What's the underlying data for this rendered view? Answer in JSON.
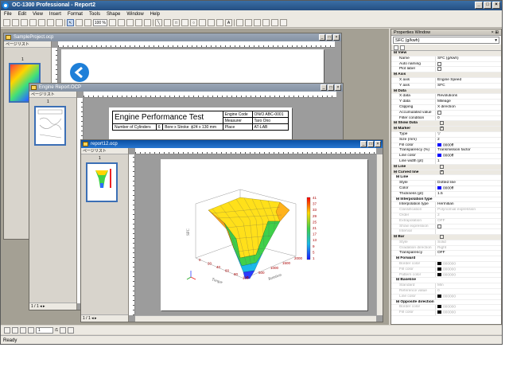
{
  "app": {
    "title": "OC-1300 Professional - Report2"
  },
  "menu": [
    "File",
    "Edit",
    "View",
    "Insert",
    "Format",
    "Tools",
    "Shape",
    "Window",
    "Help"
  ],
  "toolbar": {
    "zoom": "100 %"
  },
  "windows": {
    "sample": {
      "title": "SampleProject.ocp",
      "pagelist_label": "ページリスト",
      "page_num": "1"
    },
    "engine": {
      "title": "Engine Report.OCP",
      "pagelist_label": "ページリスト",
      "page_num": "1",
      "report": {
        "title": "Engine Performance Test",
        "engine_code_label": "Engine Code",
        "engine_code": "ON/O ABC-0001",
        "measurer_label": "Measurer",
        "measurer": "Taro Ono",
        "cyl_label": "Number of Cylinders",
        "cyl": "6",
        "bore_label": "Bore x Stroke",
        "bore": "ϕ24 x 130 mm",
        "place_label": "Place",
        "place": "AT-LAB"
      }
    },
    "report12": {
      "title": "report12.ocp",
      "pagelist_label": "ページリスト",
      "page_num": "1",
      "nav_pages": "1 / 1"
    }
  },
  "chart": {
    "zlabel": "SFC",
    "xlabel": "Torque",
    "ylabel": "Rotation",
    "colorbar_ticks": [
      "41",
      "37",
      "33",
      "29",
      "25",
      "21",
      "17",
      "13",
      "9",
      "5",
      "1"
    ],
    "x_ticks": [
      "0",
      "20",
      "40",
      "60",
      "80",
      "100"
    ],
    "y_ticks": [
      "0",
      "500",
      "1000",
      "1500",
      "2000"
    ]
  },
  "bottom": {
    "page_current": "1",
    "page_total": "/1"
  },
  "status": "Ready",
  "props": {
    "title": "Properties Window",
    "selected": "SFC (g/kwh)",
    "rows": [
      {
        "t": "sec",
        "n": "View"
      },
      {
        "n": "Name",
        "v": "SFC (g/kwh)"
      },
      {
        "n": "Auto naming",
        "c": false
      },
      {
        "n": "Plot label",
        "c": false
      },
      {
        "t": "sec",
        "n": "Axis"
      },
      {
        "n": "X axis",
        "v": "Engine Speed"
      },
      {
        "n": "Y axis",
        "v": "SFC"
      },
      {
        "t": "sec",
        "n": "Data"
      },
      {
        "n": "X data",
        "v": "Revolutions"
      },
      {
        "n": "Y data",
        "v": "Mileage"
      },
      {
        "n": "Clipping",
        "v": "X direction"
      },
      {
        "n": "Accumulated value",
        "c": false
      },
      {
        "n": "Filter condition",
        "v": "0"
      },
      {
        "t": "sec",
        "n": "Show Data",
        "c": false
      },
      {
        "t": "sec",
        "n": "Marker",
        "c": true
      },
      {
        "n": "Type",
        "v": "▽"
      },
      {
        "n": "Size (mm)",
        "v": "2"
      },
      {
        "n": "Fill color",
        "v": "0000ff",
        "sw": "#0000ff"
      },
      {
        "n": "Transparency (%)",
        "v": "Transmission factor"
      },
      {
        "n": "Line color",
        "v": "0000ff",
        "sw": "#0000ff"
      },
      {
        "n": "Line width (pt)",
        "v": "1"
      },
      {
        "t": "sec",
        "n": "Line",
        "c": false
      },
      {
        "t": "sec",
        "n": "Curved line",
        "c": true
      },
      {
        "t": "sub",
        "n": "Line"
      },
      {
        "n": "Style",
        "v": "Dotted line"
      },
      {
        "n": "Color",
        "v": "0000ff",
        "sw": "#0000ff"
      },
      {
        "n": "Thickness (pt)",
        "v": "1.5"
      },
      {
        "t": "sub",
        "n": "Interpolation type"
      },
      {
        "n": "Interpolation type",
        "v": "Hermitian"
      },
      {
        "n": "Classification",
        "v": "Polynomial expression",
        "d": true
      },
      {
        "n": "Order",
        "v": "2",
        "d": true
      },
      {
        "n": "Extrapolation",
        "v": "OFF",
        "d": true
      },
      {
        "n": "Show expression",
        "c": false,
        "d": true
      },
      {
        "n": "Interval",
        "v": "",
        "d": true
      },
      {
        "t": "sec",
        "n": "Bar",
        "c": false
      },
      {
        "n": "Style",
        "v": "Solid",
        "d": true
      },
      {
        "n": "Gradation direction",
        "v": "Right",
        "d": true
      },
      {
        "n": "Transparency",
        "v": "OFF"
      },
      {
        "t": "sub",
        "n": "Forward"
      },
      {
        "n": "Border color",
        "v": "000000",
        "sw": "#000",
        "d": true
      },
      {
        "n": "Fill color",
        "v": "000000",
        "sw": "#000",
        "d": true
      },
      {
        "n": "Pattern color",
        "v": "000000",
        "sw": "#000",
        "d": true
      },
      {
        "t": "sub",
        "n": "Baseline"
      },
      {
        "n": "Standard",
        "v": "Min",
        "d": true
      },
      {
        "n": "Reference value",
        "v": "0",
        "d": true
      },
      {
        "n": "Line color",
        "v": "000000",
        "sw": "#000",
        "d": true
      },
      {
        "t": "sub",
        "n": "Opposite direction"
      },
      {
        "n": "Border color",
        "v": "000000",
        "sw": "#000",
        "d": true
      },
      {
        "n": "Fill color",
        "v": "000000",
        "sw": "#000",
        "d": true
      }
    ]
  }
}
